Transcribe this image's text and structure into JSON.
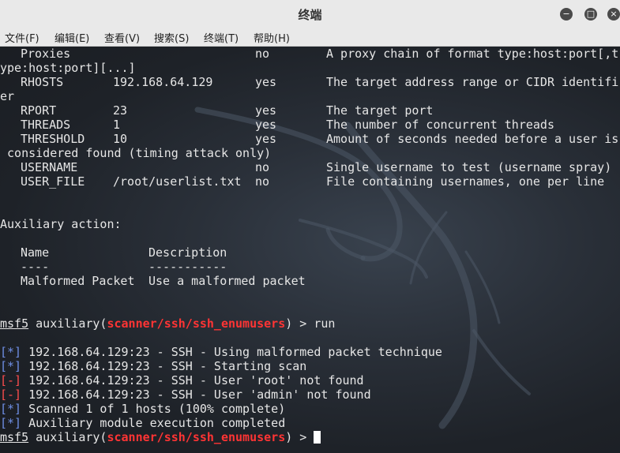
{
  "window": {
    "title": "终端",
    "buttons": {
      "minimize": "−",
      "maximize": "□",
      "close": "×"
    }
  },
  "menu": [
    "文件(F)",
    "编辑(E)",
    "查看(V)",
    "搜索(S)",
    "终端(T)",
    "帮助(H)"
  ],
  "options": {
    "proxies_name": "Proxies",
    "proxies_req": "no",
    "proxies_desc": "A proxy chain of format type:host:port[,t",
    "proxies_wrap": "ype:host:port][...]",
    "rhosts_name": "RHOSTS",
    "rhosts_val": "192.168.64.129",
    "rhosts_req": "yes",
    "rhosts_desc": "The target address range or CIDR identifi",
    "rhosts_wrap": "er",
    "rport_name": "RPORT",
    "rport_val": "23",
    "rport_req": "yes",
    "rport_desc": "The target port",
    "threads_name": "THREADS",
    "threads_val": "1",
    "threads_req": "yes",
    "threads_desc": "The number of concurrent threads",
    "threshold_name": "THRESHOLD",
    "threshold_val": "10",
    "threshold_req": "yes",
    "threshold_desc": "Amount of seconds needed before a user is",
    "threshold_wrap": " considered found (timing attack only)",
    "username_name": "USERNAME",
    "username_req": "no",
    "username_desc": "Single username to test (username spray)",
    "userfile_name": "USER_FILE",
    "userfile_val": "/root/userlist.txt",
    "userfile_req": "no",
    "userfile_desc": "File containing usernames, one per line"
  },
  "aux": {
    "heading": "Auxiliary action:",
    "col_name": "Name",
    "col_desc": "Description",
    "sep_name": "----",
    "sep_desc": "-----------",
    "action_name": "Malformed Packet",
    "action_desc": "Use a malformed packet"
  },
  "prompt": {
    "msf": "msf5",
    "pre": " auxiliary(",
    "module": "scanner/ssh/ssh_enumusers",
    "post": ") > ",
    "command": "run"
  },
  "output": [
    {
      "tag": "[*]",
      "text": " 192.168.64.129:23 - SSH - Using malformed packet technique"
    },
    {
      "tag": "[*]",
      "text": " 192.168.64.129:23 - SSH - Starting scan"
    },
    {
      "tag": "[-]",
      "text": " 192.168.64.129:23 - SSH - User 'root' not found"
    },
    {
      "tag": "[-]",
      "text": " 192.168.64.129:23 - SSH - User 'admin' not found"
    },
    {
      "tag": "[*]",
      "text": " Scanned 1 of 1 hosts (100% complete)"
    },
    {
      "tag": "[*]",
      "text": " Auxiliary module execution completed"
    }
  ],
  "colors": {
    "module": "#ff3434",
    "info_tag": "#6f8fe6",
    "error_tag": "#ff4d4d",
    "text": "#e6e6e6"
  }
}
